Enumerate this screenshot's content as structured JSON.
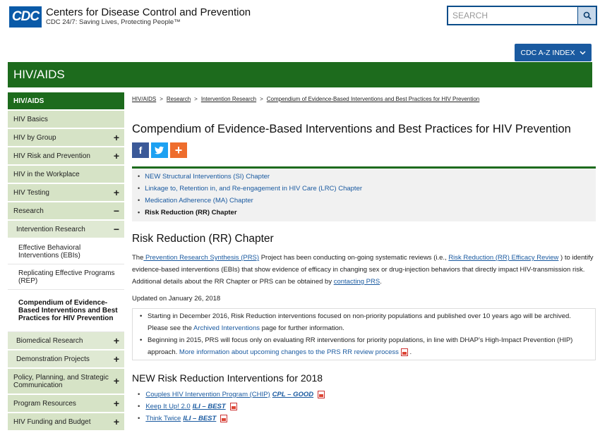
{
  "header": {
    "logo_mark": "CDC",
    "logo_title": "Centers for Disease Control and Prevention",
    "logo_subtitle": "CDC 24/7: Saving Lives, Protecting People™",
    "search_placeholder": "SEARCH",
    "search_icon": "search-icon",
    "az_index_label": "CDC A-Z INDEX",
    "az_icon": "chevron-down-icon"
  },
  "banner": {
    "title": "HIV/AIDS"
  },
  "sidebar": {
    "items": [
      {
        "label": "HIV/AIDS",
        "sign": ""
      },
      {
        "label": "HIV Basics",
        "sign": ""
      },
      {
        "label": "HIV by Group",
        "sign": "+"
      },
      {
        "label": "HIV Risk and Prevention",
        "sign": "+"
      },
      {
        "label": "HIV in the Workplace",
        "sign": ""
      },
      {
        "label": "HIV Testing",
        "sign": "+"
      },
      {
        "label": "Research",
        "sign": "−"
      },
      {
        "label": "Intervention Research",
        "sign": "−"
      },
      {
        "label": "Effective Behavioral Interventions (EBIs)",
        "sign": ""
      },
      {
        "label": "Replicating Effective Programs (REP)",
        "sign": ""
      },
      {
        "label": "Compendium of Evidence-Based Interventions and Best Practices for HIV Prevention",
        "sign": ""
      },
      {
        "label": "Biomedical Research",
        "sign": "+"
      },
      {
        "label": "Demonstration Projects",
        "sign": "+"
      },
      {
        "label": "Policy, Planning, and Strategic Communication",
        "sign": "+"
      },
      {
        "label": "Program Resources",
        "sign": "+"
      },
      {
        "label": "HIV Funding and Budget",
        "sign": "+"
      }
    ]
  },
  "breadcrumb": {
    "items": [
      "HIV/AIDS",
      "Research",
      "Intervention Research",
      "Compendium of Evidence-Based Interventions and Best Practices for HIV Prevention"
    ],
    "separator": ">"
  },
  "main": {
    "title": "Compendium of Evidence-Based Interventions and Best Practices for HIV Prevention",
    "social": {
      "facebook": "f",
      "plus": "+"
    },
    "chapters": [
      "NEW Structural Interventions (SI) Chapter",
      "Linkage to, Retention in, and Re-engagement in HIV Care (LRC) Chapter",
      "Medication Adherence (MA) Chapter",
      "Risk Reduction (RR) Chapter"
    ],
    "section_title": "Risk Reduction (RR) Chapter",
    "para": {
      "t1": "The",
      "link1": " Prevention Research Synthesis (PRS)",
      "t2": "  Project has been conducting on-going systematic reviews (i.e.,",
      "link2": "Risk Reduction (RR) Efficacy Review",
      "t3": " ) to identify evidence-based interventions (EBIs) that show evidence of efficacy in changing sex or drug-injection behaviors that directly impact HIV-transmission risk. Additional details about the RR Chapter or PRS can be obtained by",
      "link3": "contacting PRS",
      "t4": "."
    },
    "updated": "Updated on January 26, 2018",
    "notice": {
      "b1_text": "Starting in December 2016, Risk Reduction interventions focused on non-priority populations and published over 10 years ago will be archived. Please see the",
      "b1_link": "Archived Interventions",
      "b1_tail": " page for further information.",
      "b2_text": "Beginning in 2015, PRS will focus only on evaluating RR interventions for priority populations, in line with DHAP’s High-Impact Prevention (HIP) approach.",
      "b2_link": "More information about upcoming changes to the PRS RR review process",
      "b2_tail": " ."
    },
    "new_title": "NEW Risk Reduction Interventions for 2018",
    "new_items": [
      {
        "name": "Couples HIV Intervention Program (CHIP)",
        "tag": "CPL – GOOD"
      },
      {
        "name": "Keep It Up! 2.0",
        "tag": "ILI – BEST"
      },
      {
        "name": "Think Twice",
        "tag": "ILI – BEST"
      }
    ]
  }
}
